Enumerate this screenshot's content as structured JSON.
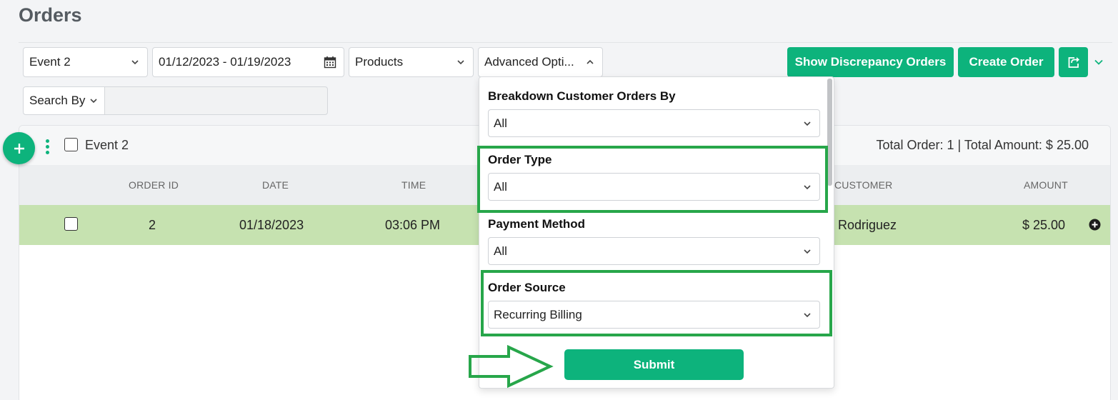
{
  "page": {
    "title": "Orders"
  },
  "filters": {
    "event": "Event 2",
    "date_range": "01/12/2023 - 01/19/2023",
    "products": "Products",
    "advanced": "Advanced Opti..."
  },
  "actions": {
    "discrepancy": "Show Discrepancy Orders",
    "create": "Create Order"
  },
  "search": {
    "by_label": "Search By",
    "value": ""
  },
  "group": {
    "name": "Event 2",
    "totals": "Total Order: 1 | Total Amount: $ 25.00"
  },
  "table": {
    "headers": {
      "order_id": "ORDER ID",
      "date": "DATE",
      "time": "TIME",
      "customer": "CUSTOMER",
      "amount": "AMOUNT"
    },
    "rows": [
      {
        "order_id": "2",
        "date": "01/18/2023",
        "time": "03:06 PM",
        "customer": "A. Rodriguez",
        "amount": "$ 25.00"
      }
    ]
  },
  "advanced_panel": {
    "breakdown": {
      "label": "Breakdown Customer Orders By",
      "value": "All"
    },
    "order_type": {
      "label": "Order Type",
      "value": "All"
    },
    "payment_method": {
      "label": "Payment Method",
      "value": "All"
    },
    "order_source": {
      "label": "Order Source",
      "value": "Recurring Billing"
    },
    "submit": "Submit"
  },
  "colors": {
    "accent": "#0db37c",
    "row_highlight": "#c6e2b0",
    "annotation": "#27a64a"
  }
}
